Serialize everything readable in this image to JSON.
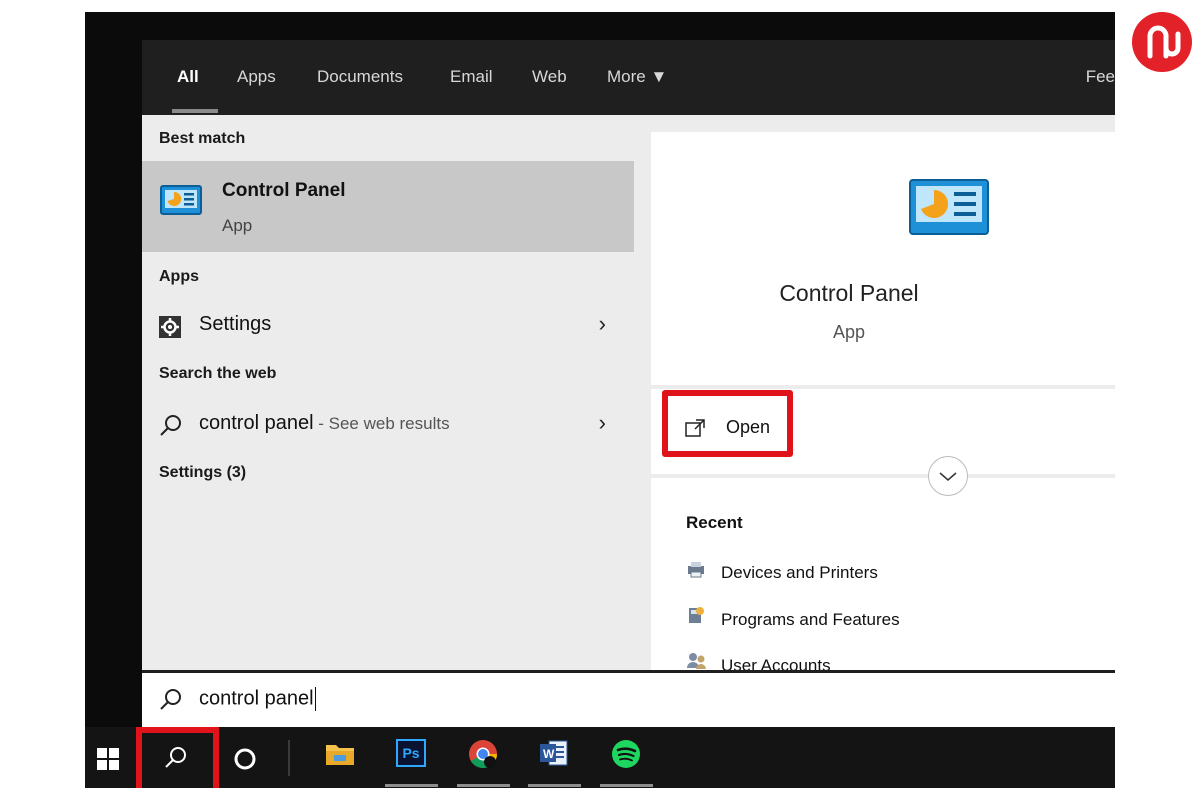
{
  "header": {
    "tabs": [
      {
        "label": "All",
        "active": true
      },
      {
        "label": "Apps"
      },
      {
        "label": "Documents"
      },
      {
        "label": "Email"
      },
      {
        "label": "Web"
      },
      {
        "label": "More ▼"
      }
    ],
    "feedback_partial": "Fee"
  },
  "left": {
    "best_match_title": "Best match",
    "best_match": {
      "name": "Control Panel",
      "type": "App"
    },
    "apps_title": "Apps",
    "apps": [
      {
        "label": "Settings",
        "icon": "gear-icon"
      }
    ],
    "web_title": "Search the web",
    "web_result": {
      "query": "control panel",
      "hint": " - See web results"
    },
    "settings_title": "Settings (3)"
  },
  "right": {
    "app_name": "Control Panel",
    "app_type": "App",
    "open_label": "Open",
    "recent_title": "Recent",
    "recent": [
      {
        "label": "Devices and Printers",
        "icon": "devices-printers-icon"
      },
      {
        "label": "Programs and Features",
        "icon": "programs-features-icon"
      },
      {
        "label": "User Accounts",
        "icon": "user-accounts-icon"
      }
    ]
  },
  "search": {
    "value": "control panel"
  },
  "taskbar": {
    "icons": [
      "windows-start-icon",
      "search-icon",
      "cortana-icon",
      "file-explorer-icon",
      "photoshop-icon",
      "chrome-icon",
      "word-icon",
      "spotify-icon"
    ],
    "ps_text": "Ps",
    "word_text": "W"
  },
  "brand": {
    "highlight_color": "#e0121a",
    "logo_color": "#e32128",
    "logo_text": "ԥ"
  }
}
